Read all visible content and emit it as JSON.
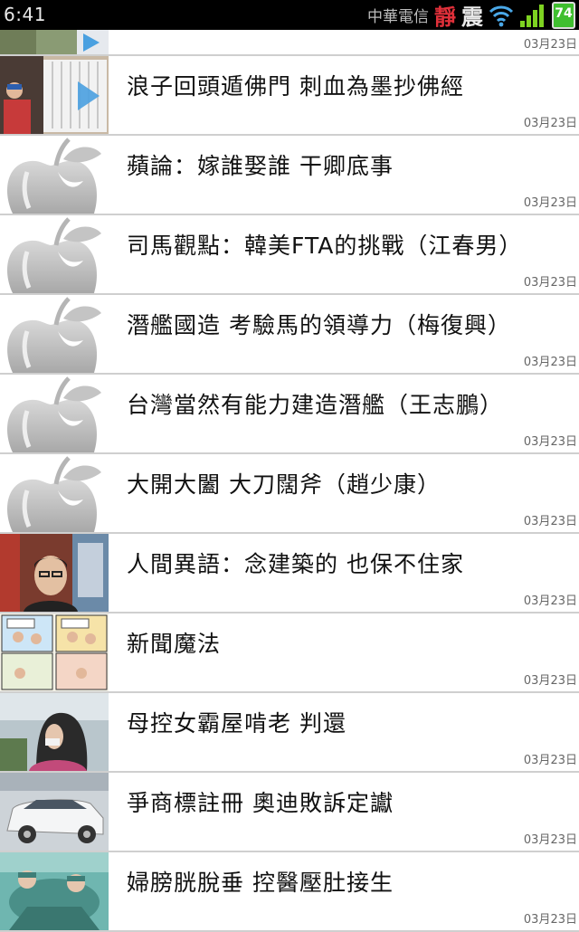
{
  "status_bar": {
    "time": "6:41",
    "carrier": "中華電信",
    "silent_label": "靜",
    "vibrate_label": "震",
    "battery_level": "74",
    "icons": [
      "wifi-icon",
      "signal-icon",
      "battery-icon"
    ]
  },
  "articles": [
    {
      "title": "",
      "date": "03月23日",
      "thumb": "photo-street"
    },
    {
      "title": "浪子回頭遁佛門 刺血為墨抄佛經",
      "date": "03月23日",
      "thumb": "photo-monk"
    },
    {
      "title": "蘋論：嫁誰娶誰 干卿底事",
      "date": "03月23日",
      "thumb": "apple-logo"
    },
    {
      "title": "司馬觀點：韓美FTA的挑戰（江春男）",
      "date": "03月23日",
      "thumb": "apple-logo"
    },
    {
      "title": "潛艦國造 考驗馬的領導力（梅復興）",
      "date": "03月23日",
      "thumb": "apple-logo"
    },
    {
      "title": "台灣當然有能力建造潛艦（王志鵬）",
      "date": "03月23日",
      "thumb": "apple-logo"
    },
    {
      "title": "大開大闔 大刀闊斧（趙少康）",
      "date": "03月23日",
      "thumb": "apple-logo"
    },
    {
      "title": "人間異語：念建築的 也保不住家",
      "date": "03月23日",
      "thumb": "photo-man"
    },
    {
      "title": "新聞魔法",
      "date": "03月23日",
      "thumb": "comic"
    },
    {
      "title": "母控女霸屋啃老 判還",
      "date": "03月23日",
      "thumb": "photo-woman"
    },
    {
      "title": "爭商標註冊 奧迪敗訴定讞",
      "date": "03月23日",
      "thumb": "photo-car"
    },
    {
      "title": "婦膀胱脫垂 控醫壓肚接生",
      "date": "03月23日",
      "thumb": "photo-hospital"
    }
  ],
  "colors": {
    "status_bar_bg": "#000000",
    "silent": "#e0303a",
    "battery": "#3fbf2f",
    "divider": "#cfcfcf"
  }
}
